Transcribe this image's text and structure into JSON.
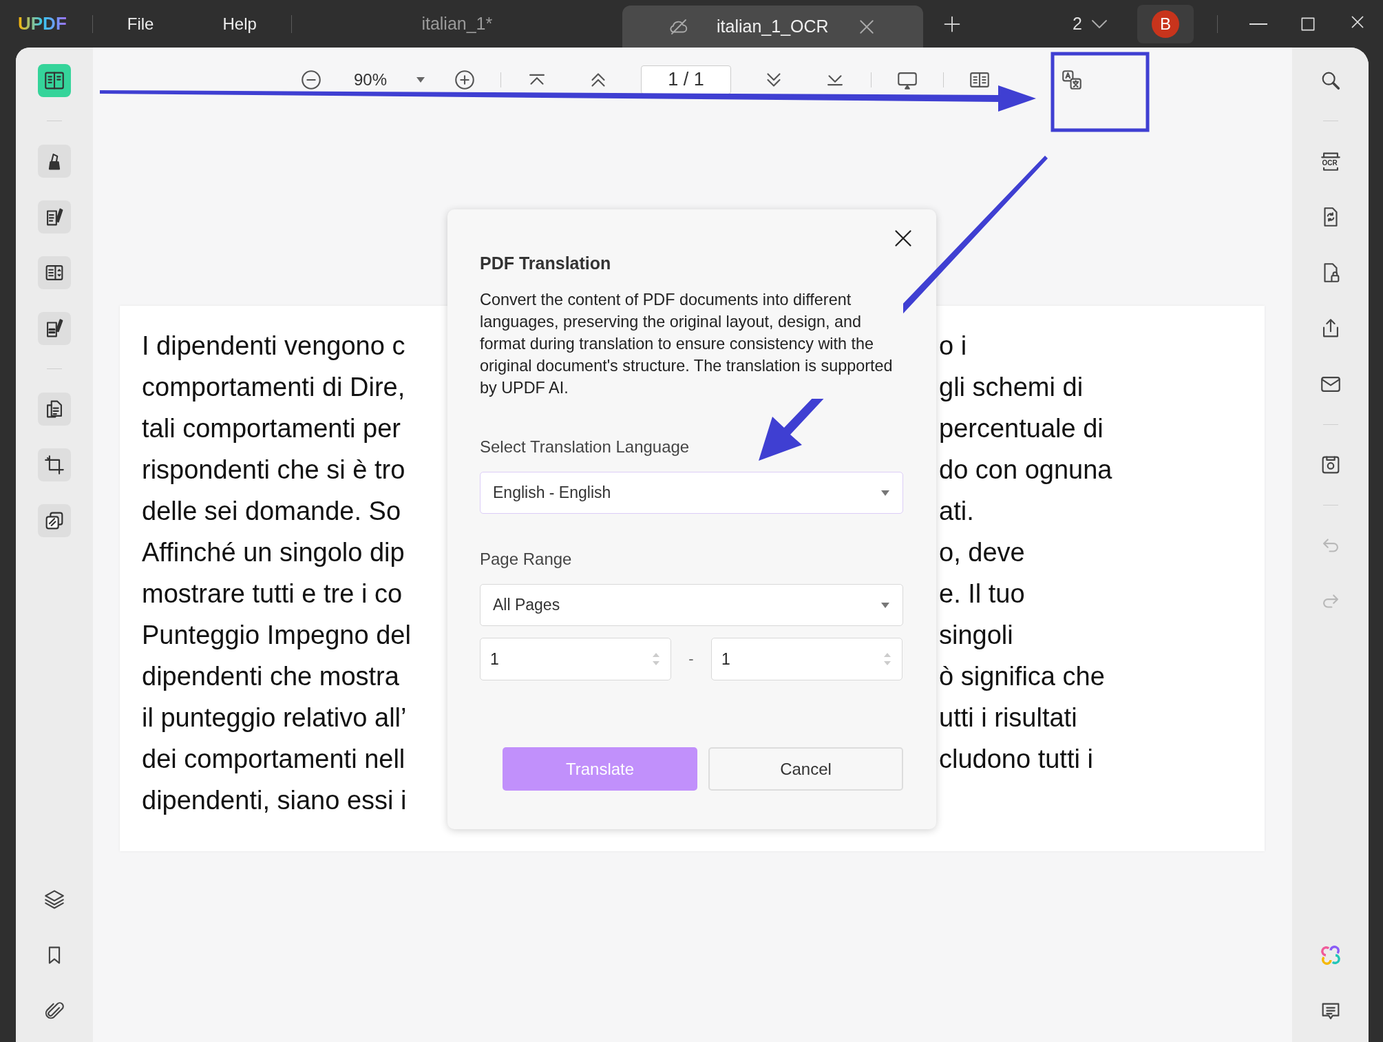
{
  "app": {
    "logo": "UPDF",
    "menu": [
      "File",
      "Help"
    ]
  },
  "tabs": [
    {
      "label": "italian_1*",
      "selected": false
    },
    {
      "label": "italian_1_OCR",
      "selected": true
    }
  ],
  "window_count": "2",
  "avatar": "B",
  "toolbar": {
    "zoom": "90%",
    "page": "1 / 1"
  },
  "left_sidebar": {
    "groups": [
      [
        {
          "kind": "reader",
          "selected": true
        }
      ],
      [
        {
          "kind": "comment",
          "selected": false
        },
        {
          "kind": "edit",
          "selected": false
        },
        {
          "kind": "form",
          "selected": false
        },
        {
          "kind": "sign",
          "selected": false
        }
      ],
      [
        {
          "kind": "organize",
          "selected": false
        },
        {
          "kind": "crop",
          "selected": false
        },
        {
          "kind": "watermark",
          "selected": false
        }
      ]
    ],
    "bottom": [
      {
        "kind": "layers"
      },
      {
        "kind": "bookmark"
      },
      {
        "kind": "attachment"
      }
    ]
  },
  "right_sidebar": {
    "groups": [
      [
        {
          "kind": "search",
          "disabled": false
        }
      ],
      [
        {
          "kind": "ocr",
          "label": "OCR",
          "disabled": false
        },
        {
          "kind": "convert",
          "disabled": false
        },
        {
          "kind": "protect",
          "disabled": false
        },
        {
          "kind": "share",
          "disabled": false
        },
        {
          "kind": "email",
          "disabled": false
        }
      ],
      [
        {
          "kind": "save",
          "disabled": false
        }
      ],
      [
        {
          "kind": "undo",
          "disabled": true
        },
        {
          "kind": "redo",
          "disabled": true
        }
      ]
    ],
    "bottom": [
      {
        "kind": "ai"
      },
      {
        "kind": "chat"
      }
    ]
  },
  "document": {
    "lines": [
      {
        "left": "I dipendenti vengono c",
        "right": "o i"
      },
      {
        "left": "comportamenti di Dire,",
        "right": "gli schemi di"
      },
      {
        "left": "tali comportamenti per",
        "right": "percentuale di"
      },
      {
        "left": "rispondenti che si è tro",
        "right": "do con ognuna"
      },
      {
        "left": "delle sei domande. So",
        "right": "ati."
      },
      {
        "left": "Affinché un singolo dip",
        "right": "o, deve"
      },
      {
        "left": "mostrare tutti e tre i co",
        "right": "e. Il tuo"
      },
      {
        "left": "Punteggio Impegno del",
        "right": "singoli"
      },
      {
        "left": "dipendenti che mostra",
        "right": "ò significa che"
      },
      {
        "left": "il punteggio relativo all’",
        "right": "utti i risultati"
      },
      {
        "left": "dei comportamenti nell",
        "right": "cludono tutti i"
      },
      {
        "left": "dipendenti, siano essi i"
      }
    ]
  },
  "dialog": {
    "title": "PDF Translation",
    "description": "Convert the content of PDF documents into different languages, preserving the original layout, design, and format during translation to ensure consistency with the original document's structure. The translation is supported by UPDF AI.",
    "language": {
      "label": "Select Translation Language",
      "value": "English - English"
    },
    "page_range": {
      "label": "Page Range",
      "value": "All Pages",
      "from": "1",
      "separator": "-",
      "to": "1"
    },
    "buttons": [
      {
        "label": "Translate",
        "kind": "primary"
      },
      {
        "label": "Cancel",
        "kind": "secondary"
      }
    ]
  }
}
